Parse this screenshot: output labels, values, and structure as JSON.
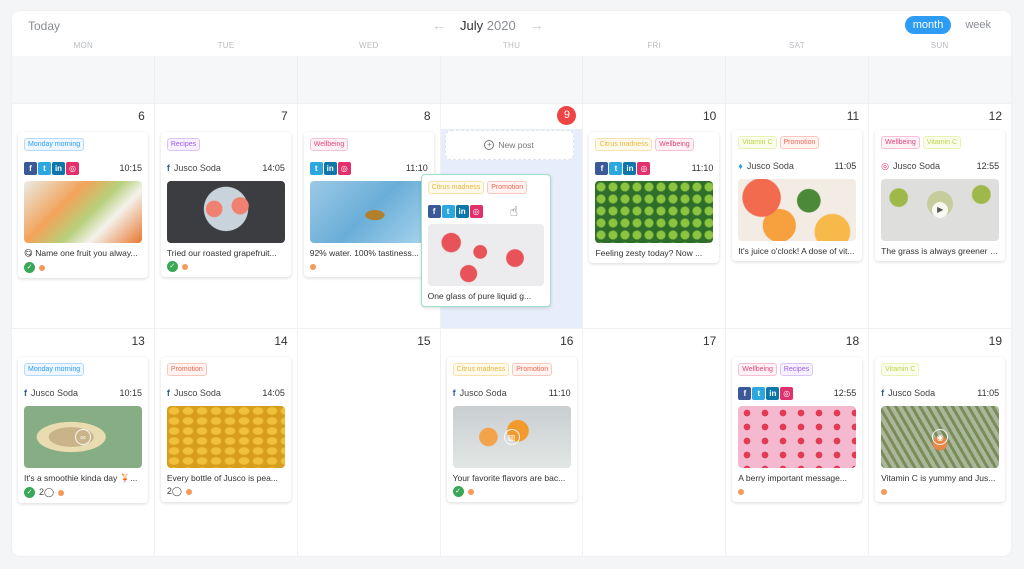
{
  "header": {
    "today_label": "Today",
    "month": "July",
    "year": "2020",
    "prev_icon": "←",
    "next_icon": "→",
    "views": [
      {
        "label": "month",
        "active": true
      },
      {
        "label": "week",
        "active": false
      }
    ]
  },
  "weekdays": [
    "MON",
    "TUE",
    "WED",
    "THU",
    "FRI",
    "SAT",
    "SUN"
  ],
  "new_post_label": "New post",
  "weeks": [
    {
      "days": [
        {
          "num": "6",
          "posts": [
            {
              "tags": [
                {
                  "label": "Monday morning",
                  "color": "blue"
                }
              ],
              "networks": [
                "fb",
                "tw",
                "li",
                "ig"
              ],
              "time": "10:15",
              "image": "fruit-assortment",
              "caption": "😋 Name one fruit you alway...",
              "approved": true,
              "comments": null
            }
          ]
        },
        {
          "num": "7",
          "posts": [
            {
              "tags": [
                {
                  "label": "Recipes",
                  "color": "purple"
                }
              ],
              "account": {
                "network": "fb",
                "name": "Jusco Soda"
              },
              "time": "14:05",
              "image": "grapefruit-plate",
              "caption": "Tried our roasted grapefruit...",
              "approved": true,
              "comments": null
            }
          ]
        },
        {
          "num": "8",
          "posts": [
            {
              "tags": [
                {
                  "label": "Wellbeing",
                  "color": "pink"
                }
              ],
              "networks": [
                "tw",
                "li",
                "ig"
              ],
              "time": "11:10",
              "image": "pineapple-pool",
              "caption": "92% water. 100% tastiness...",
              "approved": false,
              "comments": null
            }
          ]
        },
        {
          "num": "9",
          "today": true,
          "posts": [
            {
              "tags": [
                {
                  "label": "Citrus madness",
                  "color": "orange"
                },
                {
                  "label": "Promotion",
                  "color": "red"
                }
              ],
              "networks": [
                "fb",
                "tw",
                "li",
                "ig"
              ],
              "time": "",
              "image": "watermelon",
              "caption": "One glass of pure liquid g...",
              "dragging": true
            }
          ]
        },
        {
          "num": "10",
          "posts": [
            {
              "tags": [
                {
                  "label": "Citrus madness",
                  "color": "orange"
                },
                {
                  "label": "Wellbeing",
                  "color": "pink"
                }
              ],
              "networks": [
                "fb",
                "tw",
                "li",
                "ig"
              ],
              "time": "11:10",
              "image": "limes",
              "caption": "Feeling zesty today? Now ..."
            }
          ]
        },
        {
          "num": "11",
          "posts": [
            {
              "tags": [
                {
                  "label": "Vitamin C",
                  "color": "lime"
                },
                {
                  "label": "Promotion",
                  "color": "red"
                }
              ],
              "account": {
                "network": "tw",
                "name": "Jusco Soda"
              },
              "time": "11:05",
              "image": "citrus-slices",
              "caption": "It's juice o'clock! A dose of vit..."
            }
          ]
        },
        {
          "num": "12",
          "posts": [
            {
              "tags": [
                {
                  "label": "Wellbeing",
                  "color": "pink"
                },
                {
                  "label": "Vitamin C",
                  "color": "lime"
                }
              ],
              "account": {
                "network": "ig",
                "name": "Jusco Soda"
              },
              "time": "12:55",
              "image": "cucumber-glass",
              "video": true,
              "caption": "The grass is always greener o..."
            }
          ]
        }
      ]
    },
    {
      "days": [
        {
          "num": "13",
          "posts": [
            {
              "tags": [
                {
                  "label": "Monday morning",
                  "color": "blue"
                }
              ],
              "account": {
                "network": "fb",
                "name": "Jusco Soda"
              },
              "time": "10:15",
              "image": "melon",
              "link": true,
              "caption": "It's a smoothie kinda day 🍹...",
              "approved": true,
              "comments": "2"
            }
          ]
        },
        {
          "num": "14",
          "posts": [
            {
              "tags": [
                {
                  "label": "Promotion",
                  "color": "red"
                }
              ],
              "account": {
                "network": "fb",
                "name": "Jusco Soda"
              },
              "time": "14:05",
              "image": "pears",
              "caption": "Every bottle of Jusco is pea...",
              "approved": false,
              "comments": "2"
            }
          ]
        },
        {
          "num": "15",
          "posts": []
        },
        {
          "num": "16",
          "posts": [
            {
              "tags": [
                {
                  "label": "Citrus madness",
                  "color": "orange"
                },
                {
                  "label": "Promotion",
                  "color": "red"
                }
              ],
              "account": {
                "network": "fb",
                "name": "Jusco Soda"
              },
              "time": "11:10",
              "image": "oranges",
              "carousel": true,
              "caption": "Your favorite flavors are bac...",
              "approved": true
            }
          ]
        },
        {
          "num": "17",
          "posts": []
        },
        {
          "num": "18",
          "posts": [
            {
              "tags": [
                {
                  "label": "Wellbeing",
                  "color": "pink"
                },
                {
                  "label": "Recipes",
                  "color": "purple"
                }
              ],
              "networks": [
                "fb",
                "tw",
                "li",
                "ig"
              ],
              "time": "12:55",
              "image": "raspberries",
              "caption": "A berry important message..."
            }
          ]
        },
        {
          "num": "19",
          "posts": [
            {
              "tags": [
                {
                  "label": "Vitamin C",
                  "color": "lime"
                }
              ],
              "account": {
                "network": "fb",
                "name": "Jusco Soda"
              },
              "time": "11:05",
              "image": "orange-tree",
              "reel": true,
              "caption": "Vitamin C is yummy and Jus..."
            }
          ]
        }
      ]
    }
  ]
}
